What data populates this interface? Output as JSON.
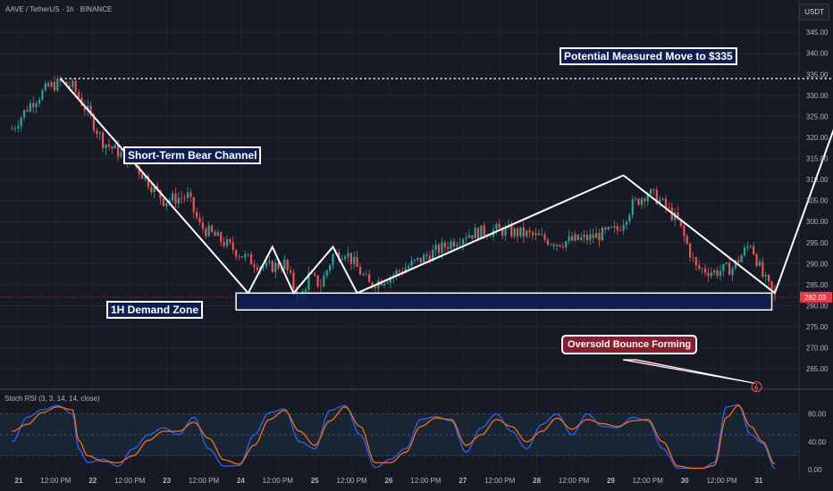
{
  "header": {
    "symbol": "AAVE / TetherUS · 1h · BINANCE",
    "currency": "USDT"
  },
  "indicator": {
    "label": "Stoch RSI (3, 3, 14, 14, close)"
  },
  "annotations": {
    "bear_channel": "Short-Term Bear Channel",
    "demand_zone": "1H Demand Zone",
    "measured_move": "Potential Measured Move to $335",
    "oversold": "Oversold Bounce Forming"
  },
  "colors": {
    "background": "#161a25",
    "up_candle": "#26a69a",
    "down_candle": "#ef5350",
    "stoch_k": "#2962ff",
    "stoch_d": "#ff6d00",
    "demand_zone_fill": "#0e1e54",
    "price_line": "#f23645"
  },
  "chart_data": [
    {
      "type": "candlestick",
      "title": "AAVE / TetherUS · 1h · BINANCE",
      "xlabel": "",
      "ylabel": "",
      "x_ticks": [
        "21",
        "12:00 PM",
        "22",
        "12:00 PM",
        "23",
        "12:00 PM",
        "24",
        "12:00 PM",
        "25",
        "12:00 PM",
        "26",
        "12:00 PM",
        "27",
        "12:00 PM",
        "28",
        "12:00 PM",
        "29",
        "12:00 PM",
        "30",
        "12:00 PM",
        "31"
      ],
      "y_ticks": [
        "345.00",
        "340.00",
        "335.00",
        "330.00",
        "325.00",
        "320.00",
        "315.00",
        "310.00",
        "305.00",
        "300.00",
        "295.00",
        "290.00",
        "285.00",
        "280.00",
        "275.00",
        "270.00",
        "265.00"
      ],
      "ylim": [
        261,
        348
      ],
      "xlim": [
        -4,
        260
      ],
      "current_price": "282.03",
      "price_path_x": [
        0,
        6,
        12,
        16,
        20,
        25,
        30,
        40,
        50,
        58,
        62,
        70,
        78,
        84,
        90,
        95,
        98,
        102,
        106,
        110,
        118,
        125,
        130,
        140,
        150,
        160,
        170,
        180,
        190,
        200,
        205,
        210,
        214,
        220,
        226,
        232,
        238,
        244,
        248,
        252
      ],
      "price_path_y": [
        322,
        328,
        332,
        333,
        332,
        326,
        319,
        314,
        305,
        306,
        299,
        295,
        291,
        289,
        290,
        281,
        287,
        285,
        292,
        293,
        285,
        287,
        289,
        293,
        297,
        298,
        297,
        295,
        296,
        298,
        304,
        307,
        305,
        300,
        289,
        288,
        289,
        295,
        287,
        282
      ],
      "annotations": [
        {
          "type": "line",
          "label": "Short-Term Bear Channel",
          "x": [
            16,
            78
          ],
          "y": [
            334,
            283
          ]
        },
        {
          "type": "polyline",
          "x": [
            78,
            86,
            93,
            106,
            114
          ],
          "y": [
            283,
            294,
            283,
            294,
            283
          ]
        },
        {
          "type": "line",
          "x": [
            114,
            202
          ],
          "y": [
            283,
            311
          ]
        },
        {
          "type": "line",
          "x": [
            202,
            252
          ],
          "y": [
            311,
            283
          ]
        },
        {
          "type": "arrow",
          "label": "Potential Measured Move to $335",
          "x": [
            252,
            276
          ],
          "y": [
            283,
            331
          ]
        },
        {
          "type": "hline",
          "x": [
            16,
            276
          ],
          "y": 334
        },
        {
          "type": "zone",
          "label": "1H Demand Zone",
          "x": [
            74,
            251
          ],
          "y": [
            279,
            283
          ]
        },
        {
          "type": "callout",
          "label": "Oversold Bounce Forming",
          "x": 246,
          "y": 262
        }
      ]
    },
    {
      "type": "line",
      "title": "Stoch RSI (3, 3, 14, 14, close)",
      "y_ticks": [
        "80.00",
        "40.00",
        "0.00"
      ],
      "ylim": [
        -5,
        100
      ],
      "bands": [
        20,
        50,
        80
      ],
      "series": [
        {
          "name": "K",
          "role": "k",
          "key_x": [
            0,
            5,
            10,
            15,
            20,
            22,
            25,
            30,
            35,
            40,
            45,
            50,
            55,
            60,
            65,
            70,
            75,
            80,
            85,
            90,
            95,
            100,
            105,
            110,
            115,
            120,
            125,
            130,
            135,
            140,
            145,
            150,
            155,
            160,
            165,
            170,
            175,
            180,
            185,
            190,
            195,
            200,
            205,
            210,
            215,
            220,
            225,
            228,
            232,
            236,
            240,
            244,
            248,
            252
          ],
          "key_y": [
            40,
            75,
            86,
            92,
            80,
            30,
            10,
            15,
            5,
            30,
            50,
            60,
            50,
            75,
            30,
            5,
            6,
            50,
            82,
            87,
            40,
            30,
            85,
            92,
            50,
            3,
            15,
            30,
            72,
            76,
            70,
            25,
            60,
            80,
            55,
            30,
            65,
            80,
            50,
            80,
            62,
            60,
            75,
            70,
            30,
            2,
            2,
            2,
            10,
            90,
            93,
            50,
            38,
            2
          ]
        },
        {
          "name": "D",
          "role": "d",
          "key_x": [
            0,
            5,
            10,
            15,
            20,
            22,
            25,
            30,
            35,
            40,
            45,
            50,
            55,
            60,
            65,
            70,
            75,
            80,
            85,
            90,
            95,
            100,
            105,
            110,
            115,
            120,
            125,
            130,
            135,
            140,
            145,
            150,
            155,
            160,
            165,
            170,
            175,
            180,
            185,
            190,
            195,
            200,
            205,
            210,
            215,
            220,
            225,
            228,
            232,
            236,
            240,
            244,
            248,
            252
          ],
          "key_y": [
            55,
            65,
            82,
            90,
            86,
            42,
            20,
            12,
            10,
            20,
            42,
            55,
            55,
            68,
            45,
            14,
            8,
            35,
            72,
            85,
            55,
            35,
            70,
            90,
            62,
            10,
            10,
            25,
            62,
            74,
            72,
            35,
            50,
            72,
            62,
            40,
            55,
            74,
            58,
            72,
            66,
            62,
            70,
            72,
            40,
            5,
            2,
            2,
            6,
            75,
            92,
            62,
            40,
            8
          ]
        }
      ]
    }
  ]
}
